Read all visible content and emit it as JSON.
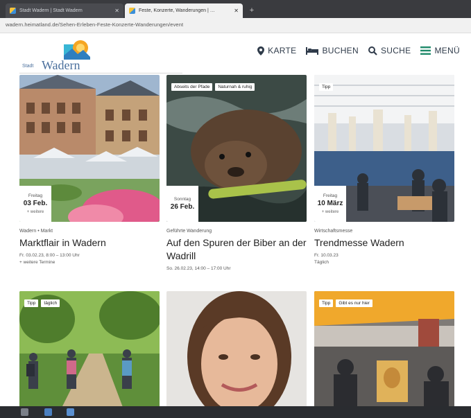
{
  "browser": {
    "tabs": [
      {
        "label": "Stadt Wadern | Stadt Wadern"
      },
      {
        "label": "Feste, Konzerte, Wanderungen | …"
      }
    ],
    "new_tab": "+",
    "url": "wadern.heimatland.de/Sehen-Erleben-Feste-Konzerte-Wanderungen/event"
  },
  "header": {
    "logo_small": "Stadt",
    "logo_big": "Wadern",
    "nav": [
      {
        "label": "KARTE",
        "icon": "map-pin-icon"
      },
      {
        "label": "BUCHEN",
        "icon": "bed-icon"
      },
      {
        "label": "SUCHE",
        "icon": "search-icon"
      },
      {
        "label": "MENÜ",
        "icon": "hamburger-icon"
      }
    ]
  },
  "cards": [
    {
      "tags": [],
      "date": {
        "weekday": "Freitag",
        "day": "03 Feb.",
        "more": "+ weitere"
      },
      "category": "Wadern • Markt",
      "title": "Marktflair in Wadern",
      "when": "Fr. 03.02.23, 8:00 – 13:00 Uhr",
      "extra": "+ weitere Termine"
    },
    {
      "tags": [
        "Abseits der Pfade",
        "Naturnah & ruhig"
      ],
      "date": {
        "weekday": "Sonntag",
        "day": "26 Feb.",
        "more": ""
      },
      "category": "Geführte Wanderung",
      "title": "Auf den Spuren der Biber an der Wadrill",
      "when": "So. 26.02.23, 14:00 – 17:00 Uhr",
      "extra": ""
    },
    {
      "tags": [
        "Tipp"
      ],
      "date": {
        "weekday": "Freitag",
        "day": "10 März",
        "more": "+ weitere"
      },
      "category": "Wirtschaftsmesse",
      "title": "Trendmesse Wadern",
      "when": "Fr. 10.03.23",
      "extra": "Täglich"
    },
    {
      "tags": [
        "Tipp",
        "täglich"
      ]
    },
    {
      "tags": []
    },
    {
      "tags": [
        "Tipp",
        "Gibt es nur hier"
      ]
    }
  ],
  "colors": {
    "accent": "#4a6f9c",
    "nav_text": "#2f3b4a",
    "menu_green": "#1f8a6a"
  }
}
